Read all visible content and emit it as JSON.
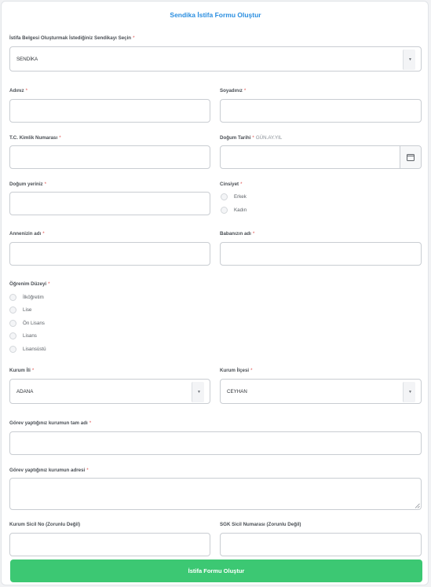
{
  "form": {
    "title": "Sendika İstifa Formu Oluştur",
    "required_mark": "*",
    "union_select": {
      "label": "İstifa Belgesi Oluşturmak İstediğiniz Sendikayı Seçin",
      "value": "SENDİKA"
    },
    "first_name": {
      "label": "Adınız"
    },
    "last_name": {
      "label": "Soyadınız"
    },
    "tc_id": {
      "label": "T.C. Kimlik Numarası"
    },
    "birth_date": {
      "label": "Doğum Tarihi",
      "hint": "GÜN.AY.YIL"
    },
    "birth_place": {
      "label": "Doğum yeriniz"
    },
    "gender": {
      "label": "Cinsiyet",
      "options": [
        "Erkek",
        "Kadın"
      ]
    },
    "mother_name": {
      "label": "Annenizin adı"
    },
    "father_name": {
      "label": "Babanızın adı"
    },
    "education": {
      "label": "Öğrenim Düzeyi",
      "options": [
        "İlköğretim",
        "Lise",
        "Ön Lisans",
        "Lisans",
        "Lisansüstü"
      ]
    },
    "province": {
      "label": "Kurum İli",
      "value": "ADANA"
    },
    "district": {
      "label": "Kurum İlçesi",
      "value": "CEYHAN"
    },
    "institution_name": {
      "label": "Görev yaptığınız kurumun tam adı"
    },
    "institution_address": {
      "label": "Görev yaptığınız kurumun adresi"
    },
    "registry_no": {
      "label": "Kurum Sicil No (Zorunlu Değil)"
    },
    "sgk_no": {
      "label": "SGK Sicil Numarası (Zorunlu Değil)"
    },
    "submit_label": "İstifa Formu Oluştur"
  },
  "colors": {
    "title": "#2a8ee0",
    "required": "#e0524f",
    "submit": "#3cc873",
    "border": "#c9cdd2"
  },
  "icons": {
    "date_picker": "calendar-icon",
    "select_arrow": "chevron-down-icon"
  }
}
